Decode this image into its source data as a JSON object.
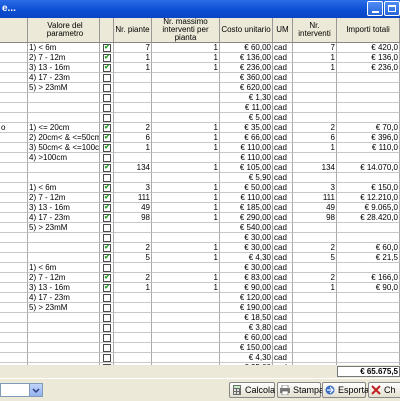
{
  "window": {
    "title": "e...",
    "accent": "#0A4CD0"
  },
  "columns": [
    "Valore del parametro",
    "Nr. piante",
    "Nr. massimo interventi per pianta",
    "Costo unitario",
    "UM",
    "Nr. interventi",
    "Importi totali"
  ],
  "rows": [
    {
      "lbl": "",
      "param": "1) < 6m",
      "chk": true,
      "np": "7",
      "nm": "1",
      "cu": "€ 60,00",
      "um": "cad",
      "ni": "7",
      "it": "€ 420,0"
    },
    {
      "lbl": "",
      "param": "2) 7 - 12m",
      "chk": true,
      "np": "1",
      "nm": "1",
      "cu": "€ 136,00",
      "um": "cad",
      "ni": "1",
      "it": "€ 136,0"
    },
    {
      "lbl": "",
      "param": "3) 13 - 16m",
      "chk": true,
      "np": "1",
      "nm": "1",
      "cu": "€ 236,00",
      "um": "cad",
      "ni": "1",
      "it": "€ 236,0"
    },
    {
      "lbl": "",
      "param": "4) 17 - 23m",
      "chk": false,
      "np": "",
      "nm": "",
      "cu": "€ 360,00",
      "um": "cad",
      "ni": "",
      "it": ""
    },
    {
      "lbl": "",
      "param": "5) > 23mM",
      "chk": false,
      "np": "",
      "nm": "",
      "cu": "€ 620,00",
      "um": "cad",
      "ni": "",
      "it": ""
    },
    {
      "lbl": "",
      "param": "",
      "chk": false,
      "np": "",
      "nm": "",
      "cu": "€ 1,30",
      "um": "cad",
      "ni": "",
      "it": ""
    },
    {
      "lbl": "",
      "param": "",
      "chk": false,
      "np": "",
      "nm": "",
      "cu": "€ 11,00",
      "um": "cad",
      "ni": "",
      "it": ""
    },
    {
      "lbl": "",
      "param": "",
      "chk": false,
      "np": "",
      "nm": "",
      "cu": "€ 5,00",
      "um": "cad",
      "ni": "",
      "it": ""
    },
    {
      "lbl": "o",
      "param": "1) <= 20cm",
      "chk": true,
      "np": "2",
      "nm": "1",
      "cu": "€ 35,00",
      "um": "cad",
      "ni": "2",
      "it": "€ 70,0"
    },
    {
      "lbl": "",
      "param": "2) 20cm< & <=50cm",
      "chk": true,
      "np": "6",
      "nm": "1",
      "cu": "€ 66,00",
      "um": "cad",
      "ni": "6",
      "it": "€ 396,0"
    },
    {
      "lbl": "",
      "param": "3) 50cm< & <=100cm",
      "chk": true,
      "np": "1",
      "nm": "1",
      "cu": "€ 110,00",
      "um": "cad",
      "ni": "1",
      "it": "€ 110,0"
    },
    {
      "lbl": "",
      "param": "4) >100cm",
      "chk": false,
      "np": "",
      "nm": "",
      "cu": "€ 110,00",
      "um": "cad",
      "ni": "",
      "it": ""
    },
    {
      "lbl": "",
      "param": "",
      "chk": true,
      "np": "134",
      "nm": "1",
      "cu": "€ 105,00",
      "um": "cad",
      "ni": "134",
      "it": "€ 14.070,0"
    },
    {
      "lbl": "",
      "param": "",
      "chk": false,
      "np": "",
      "nm": "",
      "cu": "€ 5,90",
      "um": "cad",
      "ni": "",
      "it": ""
    },
    {
      "lbl": "",
      "param": "1) < 6m",
      "chk": true,
      "np": "3",
      "nm": "1",
      "cu": "€ 50,00",
      "um": "cad",
      "ni": "3",
      "it": "€ 150,0"
    },
    {
      "lbl": "",
      "param": "2) 7 - 12m",
      "chk": true,
      "np": "111",
      "nm": "1",
      "cu": "€ 110,00",
      "um": "cad",
      "ni": "111",
      "it": "€ 12.210,0"
    },
    {
      "lbl": "",
      "param": "3) 13 - 16m",
      "chk": true,
      "np": "49",
      "nm": "1",
      "cu": "€ 185,00",
      "um": "cad",
      "ni": "49",
      "it": "€ 9.065,0"
    },
    {
      "lbl": "",
      "param": "4) 17 - 23m",
      "chk": true,
      "np": "98",
      "nm": "1",
      "cu": "€ 290,00",
      "um": "cad",
      "ni": "98",
      "it": "€ 28.420,0"
    },
    {
      "lbl": "",
      "param": "5) > 23mM",
      "chk": false,
      "np": "",
      "nm": "",
      "cu": "€ 540,00",
      "um": "cad",
      "ni": "",
      "it": ""
    },
    {
      "lbl": "",
      "param": "",
      "chk": false,
      "np": "",
      "nm": "",
      "cu": "€ 30,00",
      "um": "cad",
      "ni": "",
      "it": ""
    },
    {
      "lbl": "",
      "param": "",
      "chk": true,
      "np": "2",
      "nm": "1",
      "cu": "€ 30,00",
      "um": "cad",
      "ni": "2",
      "it": "€ 60,0"
    },
    {
      "lbl": "",
      "param": "",
      "chk": true,
      "np": "5",
      "nm": "1",
      "cu": "€ 4,30",
      "um": "cad",
      "ni": "5",
      "it": "€ 21,5"
    },
    {
      "lbl": "",
      "param": "1) < 6m",
      "chk": false,
      "np": "",
      "nm": "",
      "cu": "€ 30,00",
      "um": "cad",
      "ni": "",
      "it": ""
    },
    {
      "lbl": "",
      "param": "2) 7 - 12m",
      "chk": true,
      "np": "2",
      "nm": "1",
      "cu": "€ 83,00",
      "um": "cad",
      "ni": "2",
      "it": "€ 166,0"
    },
    {
      "lbl": "",
      "param": "3) 13 - 16m",
      "chk": true,
      "np": "1",
      "nm": "1",
      "cu": "€ 90,00",
      "um": "cad",
      "ni": "1",
      "it": "€ 90,0"
    },
    {
      "lbl": "",
      "param": "4) 17 - 23m",
      "chk": false,
      "np": "",
      "nm": "",
      "cu": "€ 120,00",
      "um": "cad",
      "ni": "",
      "it": ""
    },
    {
      "lbl": "",
      "param": "5) > 23mM",
      "chk": false,
      "np": "",
      "nm": "",
      "cu": "€ 190,00",
      "um": "cad",
      "ni": "",
      "it": ""
    },
    {
      "lbl": "",
      "param": "",
      "chk": false,
      "np": "",
      "nm": "",
      "cu": "€ 18,50",
      "um": "cad",
      "ni": "",
      "it": ""
    },
    {
      "lbl": "",
      "param": "",
      "chk": false,
      "np": "",
      "nm": "",
      "cu": "€ 3,80",
      "um": "cad",
      "ni": "",
      "it": ""
    },
    {
      "lbl": "",
      "param": "",
      "chk": false,
      "np": "",
      "nm": "",
      "cu": "€ 60,00",
      "um": "cad",
      "ni": "",
      "it": ""
    },
    {
      "lbl": "",
      "param": "",
      "chk": false,
      "np": "",
      "nm": "",
      "cu": "€ 150,00",
      "um": "cad",
      "ni": "",
      "it": ""
    },
    {
      "lbl": "",
      "param": "",
      "chk": false,
      "np": "",
      "nm": "",
      "cu": "€ 4,30",
      "um": "cad",
      "ni": "",
      "it": ""
    },
    {
      "lbl": "",
      "param": "",
      "chk": false,
      "np": "",
      "nm": "",
      "cu": "€ 25,00",
      "um": "cad",
      "ni": "",
      "it": ""
    }
  ],
  "total": "€ 65.675,5",
  "buttons": {
    "calcola": "Calcola",
    "stampa": "Stampa",
    "esporta": "Esporta",
    "chiudi": "Ch"
  }
}
